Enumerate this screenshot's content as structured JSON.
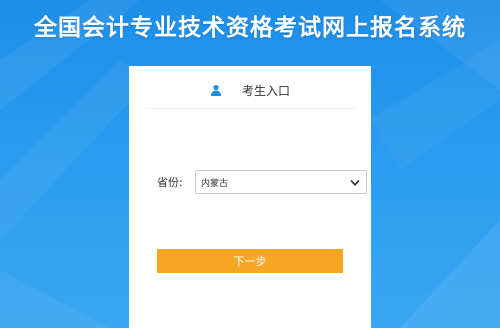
{
  "page": {
    "title": "全国会计专业技术资格考试网上报名系统"
  },
  "login_panel": {
    "tab_icon": "user-icon",
    "tab_label": "考生入口",
    "province": {
      "label": "省份:",
      "selected": "内蒙古",
      "dropdown_icon": "chevron-down-icon"
    },
    "next_button_label": "下一步"
  },
  "colors": {
    "background": "#2a9bf0",
    "panel": "#ffffff",
    "button": "#f6a623",
    "user_icon": "#1a8fe6"
  }
}
